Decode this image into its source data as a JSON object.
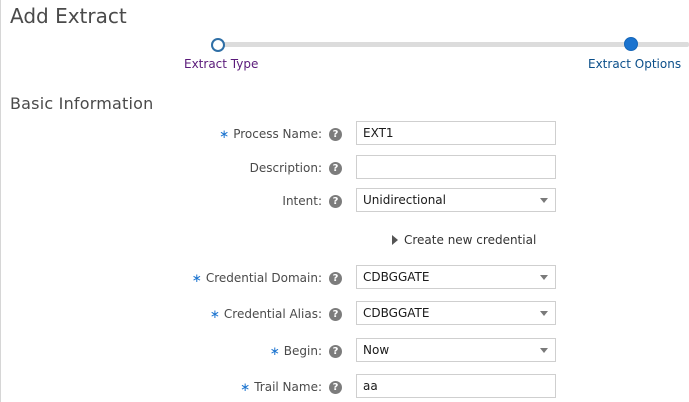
{
  "page": {
    "title": "Add Extract"
  },
  "train": {
    "steps": [
      {
        "label": "Extract Type"
      },
      {
        "label": "Extract Options"
      }
    ]
  },
  "section": {
    "title": "Basic Information"
  },
  "form": {
    "process_name": {
      "label": "Process Name:",
      "required": true,
      "value": "EXT1"
    },
    "description": {
      "label": "Description:",
      "required": false,
      "value": ""
    },
    "intent": {
      "label": "Intent:",
      "required": false,
      "value": "Unidirectional"
    },
    "create_credential": {
      "label": "Create new credential"
    },
    "credential_domain": {
      "label": "Credential Domain:",
      "required": true,
      "value": "CDBGGATE"
    },
    "credential_alias": {
      "label": "Credential Alias:",
      "required": true,
      "value": "CDBGGATE"
    },
    "begin": {
      "label": "Begin:",
      "required": true,
      "value": "Now"
    },
    "trail_name": {
      "label": "Trail Name:",
      "required": true,
      "value": "aa"
    },
    "required_marker": "∗",
    "help_glyph": "?"
  }
}
